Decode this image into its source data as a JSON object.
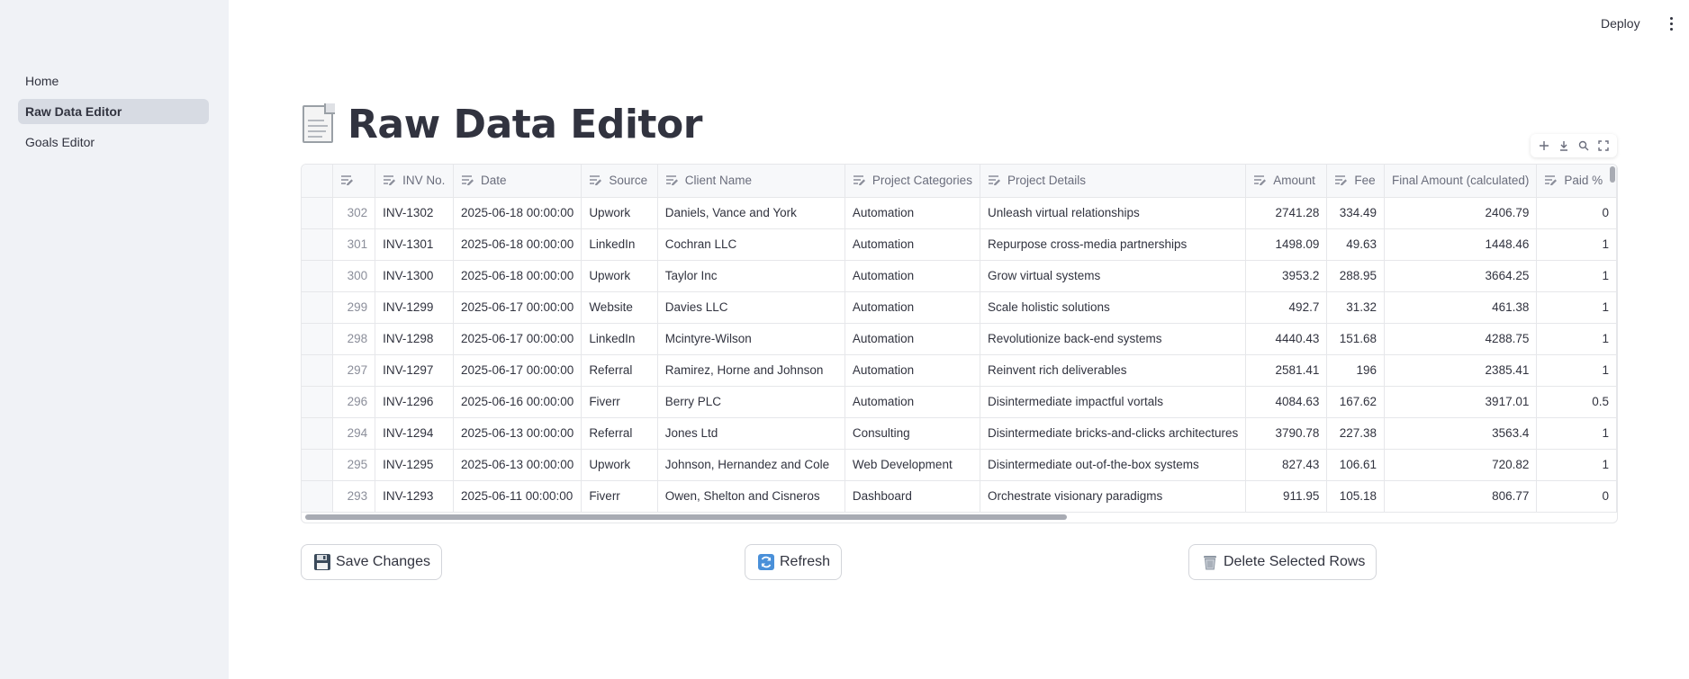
{
  "header": {
    "deploy_label": "Deploy"
  },
  "sidebar": {
    "items": [
      {
        "label": "Home",
        "active": false
      },
      {
        "label": "Raw Data Editor",
        "active": true
      },
      {
        "label": "Goals Editor",
        "active": false
      }
    ]
  },
  "page": {
    "title": "Raw Data Editor",
    "title_icon": "page-facing-up-icon"
  },
  "toolbar": {
    "icons": [
      "plus-icon",
      "download-icon",
      "search-icon",
      "fullscreen-icon"
    ]
  },
  "table": {
    "columns": [
      "INV No.",
      "Date",
      "Source",
      "Client Name",
      "Project Categories",
      "Project Details",
      "Amount",
      "Fee",
      "Final Amount (calculated)",
      "Paid %"
    ],
    "editable": [
      true,
      true,
      true,
      true,
      true,
      true,
      true,
      true,
      false,
      true
    ],
    "rows": [
      {
        "index": "302",
        "cells": [
          "INV-1302",
          "2025-06-18 00:00:00",
          "Upwork",
          "Daniels, Vance and York",
          "Automation",
          "Unleash virtual relationships",
          "2741.28",
          "334.49",
          "2406.79",
          "0"
        ]
      },
      {
        "index": "301",
        "cells": [
          "INV-1301",
          "2025-06-18 00:00:00",
          "LinkedIn",
          "Cochran LLC",
          "Automation",
          "Repurpose cross-media partnerships",
          "1498.09",
          "49.63",
          "1448.46",
          "1"
        ]
      },
      {
        "index": "300",
        "cells": [
          "INV-1300",
          "2025-06-18 00:00:00",
          "Upwork",
          "Taylor Inc",
          "Automation",
          "Grow virtual systems",
          "3953.2",
          "288.95",
          "3664.25",
          "1"
        ]
      },
      {
        "index": "299",
        "cells": [
          "INV-1299",
          "2025-06-17 00:00:00",
          "Website",
          "Davies LLC",
          "Automation",
          "Scale holistic solutions",
          "492.7",
          "31.32",
          "461.38",
          "1"
        ]
      },
      {
        "index": "298",
        "cells": [
          "INV-1298",
          "2025-06-17 00:00:00",
          "LinkedIn",
          "Mcintyre-Wilson",
          "Automation",
          "Revolutionize back-end systems",
          "4440.43",
          "151.68",
          "4288.75",
          "1"
        ]
      },
      {
        "index": "297",
        "cells": [
          "INV-1297",
          "2025-06-17 00:00:00",
          "Referral",
          "Ramirez, Horne and Johnson",
          "Automation",
          "Reinvent rich deliverables",
          "2581.41",
          "196",
          "2385.41",
          "1"
        ]
      },
      {
        "index": "296",
        "cells": [
          "INV-1296",
          "2025-06-16 00:00:00",
          "Fiverr",
          "Berry PLC",
          "Automation",
          "Disintermediate impactful vortals",
          "4084.63",
          "167.62",
          "3917.01",
          "0.5"
        ]
      },
      {
        "index": "294",
        "cells": [
          "INV-1294",
          "2025-06-13 00:00:00",
          "Referral",
          "Jones Ltd",
          "Consulting",
          "Disintermediate bricks-and-clicks architectures",
          "3790.78",
          "227.38",
          "3563.4",
          "1"
        ]
      },
      {
        "index": "295",
        "cells": [
          "INV-1295",
          "2025-06-13 00:00:00",
          "Upwork",
          "Johnson, Hernandez and Cole",
          "Web Development",
          "Disintermediate out-of-the-box systems",
          "827.43",
          "106.61",
          "720.82",
          "1"
        ]
      },
      {
        "index": "293",
        "cells": [
          "INV-1293",
          "2025-06-11 00:00:00",
          "Fiverr",
          "Owen, Shelton and Cisneros",
          "Dashboard",
          "Orchestrate visionary paradigms",
          "911.95",
          "105.18",
          "806.77",
          "0"
        ]
      }
    ]
  },
  "buttons": {
    "save": {
      "label": "Save Changes",
      "icon": "floppy-disk-icon"
    },
    "refresh": {
      "label": "Refresh",
      "icon": "refresh-icon"
    },
    "delete": {
      "label": "Delete Selected Rows",
      "icon": "wastebasket-icon"
    }
  },
  "colors": {
    "sidebar_bg": "#f0f2f6",
    "active_nav_bg": "#d7dbe3",
    "text": "#31333f",
    "header_text": "#6a6d7c"
  }
}
